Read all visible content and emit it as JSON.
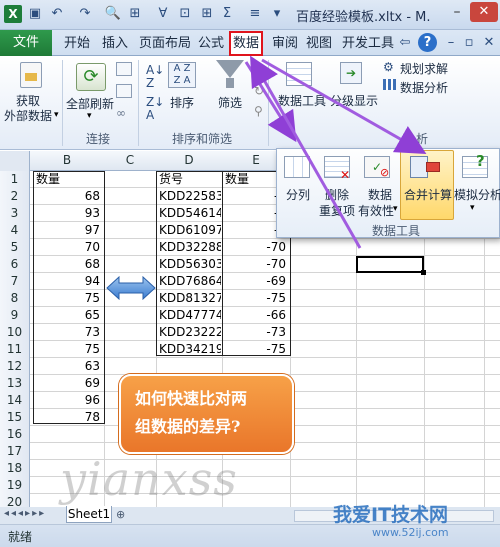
{
  "window": {
    "title": "百度经验模板.xltx - M.",
    "app_icon": "X"
  },
  "ribbon_tabs": [
    "文件",
    "开始",
    "插入",
    "页面布局",
    "公式",
    "数据",
    "审阅",
    "视图",
    "开发工具"
  ],
  "ribbon": {
    "get_external_data": [
      "获取",
      "外部数据"
    ],
    "refresh_all": "全部刷新",
    "sort": "排序",
    "filter": "筛选",
    "data_tools": "数据工具",
    "outline": "分级显示",
    "solver": "规划求解",
    "data_analysis": "数据分析",
    "groups": {
      "connections": "连接",
      "sort_filter": "排序和筛选",
      "analysis": "分析"
    }
  },
  "popup": {
    "split": "分列",
    "remove_dup": [
      "删除",
      "重复项"
    ],
    "validation": [
      "数据",
      "有效性"
    ],
    "consolidate": "合并计算",
    "what_if": "模拟分析",
    "group_label": "数据工具"
  },
  "columns": [
    "B",
    "C",
    "D",
    "E"
  ],
  "rows": [
    "1",
    "2",
    "3",
    "4",
    "5",
    "6",
    "7",
    "8",
    "9",
    "10",
    "11",
    "12",
    "13",
    "14",
    "15",
    "16",
    "17",
    "18",
    "19",
    "20"
  ],
  "col_b": {
    "header": "数量",
    "values": [
      "68",
      "93",
      "97",
      "70",
      "68",
      "94",
      "75",
      "65",
      "73",
      "75",
      "63",
      "69",
      "96",
      "78"
    ]
  },
  "col_d": {
    "header": "货号",
    "values": [
      "KDD22583",
      "KDD54614",
      "KDD61097",
      "KDD32288",
      "KDD56303",
      "KDD76864",
      "KDD81327",
      "KDD47774",
      "KDD23222",
      "KDD34219"
    ]
  },
  "col_e": {
    "header": "数量",
    "values": [
      "-6",
      "-6",
      "-6",
      "-70",
      "-70",
      "-69",
      "-75",
      "-66",
      "-73",
      "-75"
    ]
  },
  "callout": [
    "如何快速比对两",
    "组数据的差异?"
  ],
  "sheet_tab": "Sheet1",
  "status": "就绪",
  "watermark": "yianxss",
  "site_watermark": "我爱IT技术网",
  "site_url": "www.52ij.com"
}
